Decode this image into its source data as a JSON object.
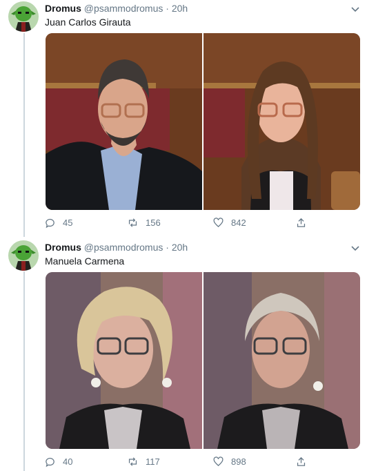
{
  "tweets": [
    {
      "display_name": "Dromus",
      "handle": "@psammodromus",
      "separator": "·",
      "time": "20h",
      "text": "Juan Carlos Girauta",
      "reply_count": "45",
      "retweet_count": "156",
      "like_count": "842"
    },
    {
      "display_name": "Dromus",
      "handle": "@psammodromus",
      "separator": "·",
      "time": "20h",
      "text": "Manuela Carmena",
      "reply_count": "40",
      "retweet_count": "117",
      "like_count": "898"
    }
  ],
  "icons": {
    "reply": "reply-icon",
    "retweet": "retweet-icon",
    "like": "heart-icon",
    "share": "share-icon",
    "more": "chevron-down-icon"
  },
  "colors": {
    "text": "#14171a",
    "secondary": "#657786",
    "thread_line": "#ccd6dd"
  }
}
